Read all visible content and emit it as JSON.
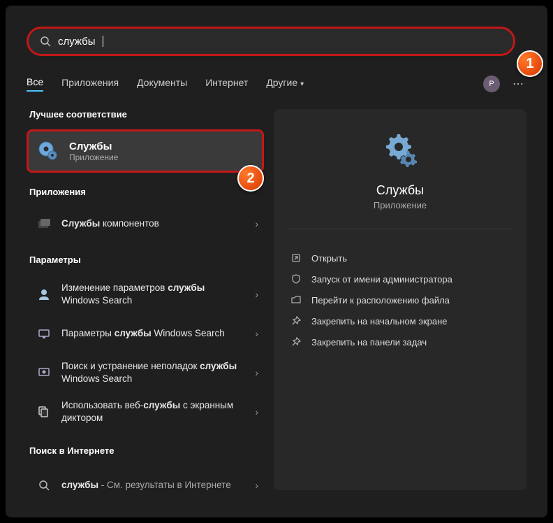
{
  "search": {
    "value": "службы"
  },
  "tabs": [
    "Все",
    "Приложения",
    "Документы",
    "Интернет",
    "Другие"
  ],
  "avatar_letter": "P",
  "sections": {
    "best_label": "Лучшее соответствие",
    "apps_label": "Приложения",
    "params_label": "Параметры",
    "web_label": "Поиск в Интернете"
  },
  "best_match": {
    "title": "Службы",
    "subtitle": "Приложение"
  },
  "apps_items": [
    {
      "text_html": "<b>Службы</b> компонентов"
    }
  ],
  "params_items": [
    {
      "text_html": "Изменение параметров <b>службы</b> Windows Search"
    },
    {
      "text_html": "Параметры <b>службы</b> Windows Search"
    },
    {
      "text_html": "Поиск и устранение неполадок <b>службы</b> Windows Search"
    },
    {
      "text_html": "Использовать веб-<b>службы</b> с экранным диктором"
    }
  ],
  "web_items": [
    {
      "text_html": "<b>службы</b> <span class='dim'>- См. результаты в Интернете</span>"
    }
  ],
  "preview": {
    "title": "Службы",
    "subtitle": "Приложение"
  },
  "actions": [
    "Открыть",
    "Запуск от имени администратора",
    "Перейти к расположению файла",
    "Закрепить на начальном экране",
    "Закрепить на панели задач"
  ],
  "badges": {
    "one": "1",
    "two": "2"
  }
}
